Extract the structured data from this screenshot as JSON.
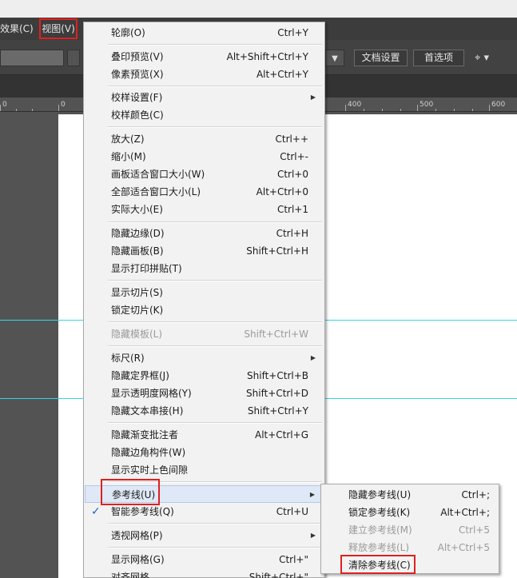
{
  "menubar": {
    "effect": "效果(C)",
    "view": "视图(V)"
  },
  "controlbar": {
    "doc_settings": "文档设置",
    "preferences": "首选项"
  },
  "ruler": {
    "labels": [
      "0",
      "0",
      "400",
      "500",
      "600"
    ]
  },
  "view_menu": {
    "items": [
      {
        "label": "轮廓(O)",
        "shortcut": "Ctrl+Y"
      },
      {
        "label": "叠印预览(V)",
        "shortcut": "Alt+Shift+Ctrl+Y"
      },
      {
        "label": "像素预览(X)",
        "shortcut": "Alt+Ctrl+Y"
      },
      {
        "label": "校样设置(F)",
        "shortcut": ""
      },
      {
        "label": "校样颜色(C)",
        "shortcut": ""
      },
      {
        "label": "放大(Z)",
        "shortcut": "Ctrl++"
      },
      {
        "label": "缩小(M)",
        "shortcut": "Ctrl+-"
      },
      {
        "label": "画板适合窗口大小(W)",
        "shortcut": "Ctrl+0"
      },
      {
        "label": "全部适合窗口大小(L)",
        "shortcut": "Alt+Ctrl+0"
      },
      {
        "label": "实际大小(E)",
        "shortcut": "Ctrl+1"
      },
      {
        "label": "隐藏边缘(D)",
        "shortcut": "Ctrl+H"
      },
      {
        "label": "隐藏画板(B)",
        "shortcut": "Shift+Ctrl+H"
      },
      {
        "label": "显示打印拼贴(T)",
        "shortcut": ""
      },
      {
        "label": "显示切片(S)",
        "shortcut": ""
      },
      {
        "label": "锁定切片(K)",
        "shortcut": ""
      },
      {
        "label": "隐藏模板(L)",
        "shortcut": "Shift+Ctrl+W"
      },
      {
        "label": "标尺(R)",
        "shortcut": ""
      },
      {
        "label": "隐藏定界框(J)",
        "shortcut": "Shift+Ctrl+B"
      },
      {
        "label": "显示透明度网格(Y)",
        "shortcut": "Shift+Ctrl+D"
      },
      {
        "label": "隐藏文本串接(H)",
        "shortcut": "Shift+Ctrl+Y"
      },
      {
        "label": "隐藏渐变批注者",
        "shortcut": "Alt+Ctrl+G"
      },
      {
        "label": "隐藏边角构件(W)",
        "shortcut": ""
      },
      {
        "label": "显示实时上色间隙",
        "shortcut": ""
      },
      {
        "label": "参考线(U)",
        "shortcut": ""
      },
      {
        "label": "智能参考线(Q)",
        "shortcut": "Ctrl+U"
      },
      {
        "label": "透视网格(P)",
        "shortcut": ""
      },
      {
        "label": "显示网格(G)",
        "shortcut": "Ctrl+\""
      },
      {
        "label": "对齐网格",
        "shortcut": "Shift+Ctrl+\""
      }
    ]
  },
  "guides_submenu": {
    "items": [
      {
        "label": "隐藏参考线(U)",
        "shortcut": "Ctrl+;"
      },
      {
        "label": "锁定参考线(K)",
        "shortcut": "Alt+Ctrl+;"
      },
      {
        "label": "建立参考线(M)",
        "shortcut": "Ctrl+5"
      },
      {
        "label": "释放参考线(L)",
        "shortcut": "Alt+Ctrl+5"
      },
      {
        "label": "清除参考线(C)",
        "shortcut": ""
      }
    ]
  },
  "colors": {
    "guide": "#33d6e6",
    "highlight_box": "#e02020",
    "check": "#1e63c6"
  },
  "icons": {
    "check": "checkmark-icon",
    "submenu": "chevron-right-icon"
  }
}
